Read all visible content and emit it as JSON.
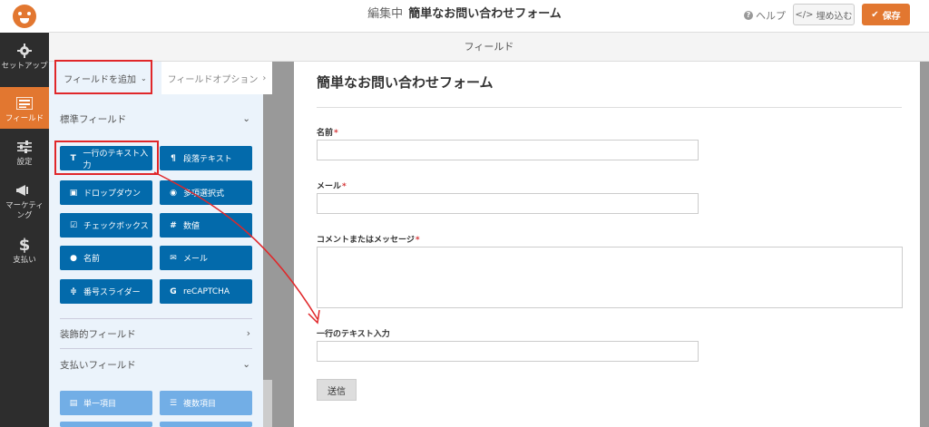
{
  "header": {
    "title_prefix": "編集中",
    "form_name": "簡単なお問い合わせフォーム",
    "help_label": "ヘルプ",
    "embed_label": "埋め込む",
    "save_label": "保存"
  },
  "leftnav": {
    "items": [
      {
        "label": "セットアップ",
        "icon": "gear-icon"
      },
      {
        "label": "フィールド",
        "icon": "list-icon",
        "active": true
      },
      {
        "label": "設定",
        "icon": "sliders-icon"
      },
      {
        "label": "マーケティング",
        "icon": "megaphone-icon"
      },
      {
        "label": "支払い",
        "icon": "dollar-icon"
      }
    ]
  },
  "fields_strip": {
    "label": "フィールド"
  },
  "panel": {
    "tab_add": "フィールドを追加",
    "tab_options": "フィールドオプション",
    "standard_fields": "標準フィールド",
    "standard_buttons": [
      {
        "label": "一行のテキスト入力",
        "icon": "text-icon"
      },
      {
        "label": "段落テキスト",
        "icon": "paragraph-icon"
      },
      {
        "label": "ドロップダウン",
        "icon": "dropdown-icon"
      },
      {
        "label": "多項選択式",
        "icon": "radio-icon"
      },
      {
        "label": "チェックボックス",
        "icon": "checkbox-icon"
      },
      {
        "label": "数値",
        "icon": "hash-icon"
      },
      {
        "label": "名前",
        "icon": "user-icon"
      },
      {
        "label": "メール",
        "icon": "mail-icon"
      },
      {
        "label": "番号スライダー",
        "icon": "slider-icon"
      },
      {
        "label": "reCAPTCHA",
        "icon": "google-icon"
      }
    ],
    "fancy_fields": "装飾的フィールド",
    "payment_fields": "支払いフィールド",
    "payment_buttons": [
      {
        "label": "単一項目",
        "icon": "file-icon"
      },
      {
        "label": "複数項目",
        "icon": "list-icon"
      }
    ]
  },
  "form": {
    "title": "簡単なお問い合わせフォーム",
    "fields": [
      {
        "label": "名前",
        "required": "*"
      },
      {
        "label": "メール",
        "required": "*"
      },
      {
        "label": "コメントまたはメッセージ",
        "required": "*"
      },
      {
        "label": "一行のテキスト入力",
        "required": ""
      }
    ],
    "submit_label": "送信"
  },
  "colors": {
    "accent": "#e27730",
    "field_button": "#036aab",
    "annotation": "#e0272a"
  }
}
